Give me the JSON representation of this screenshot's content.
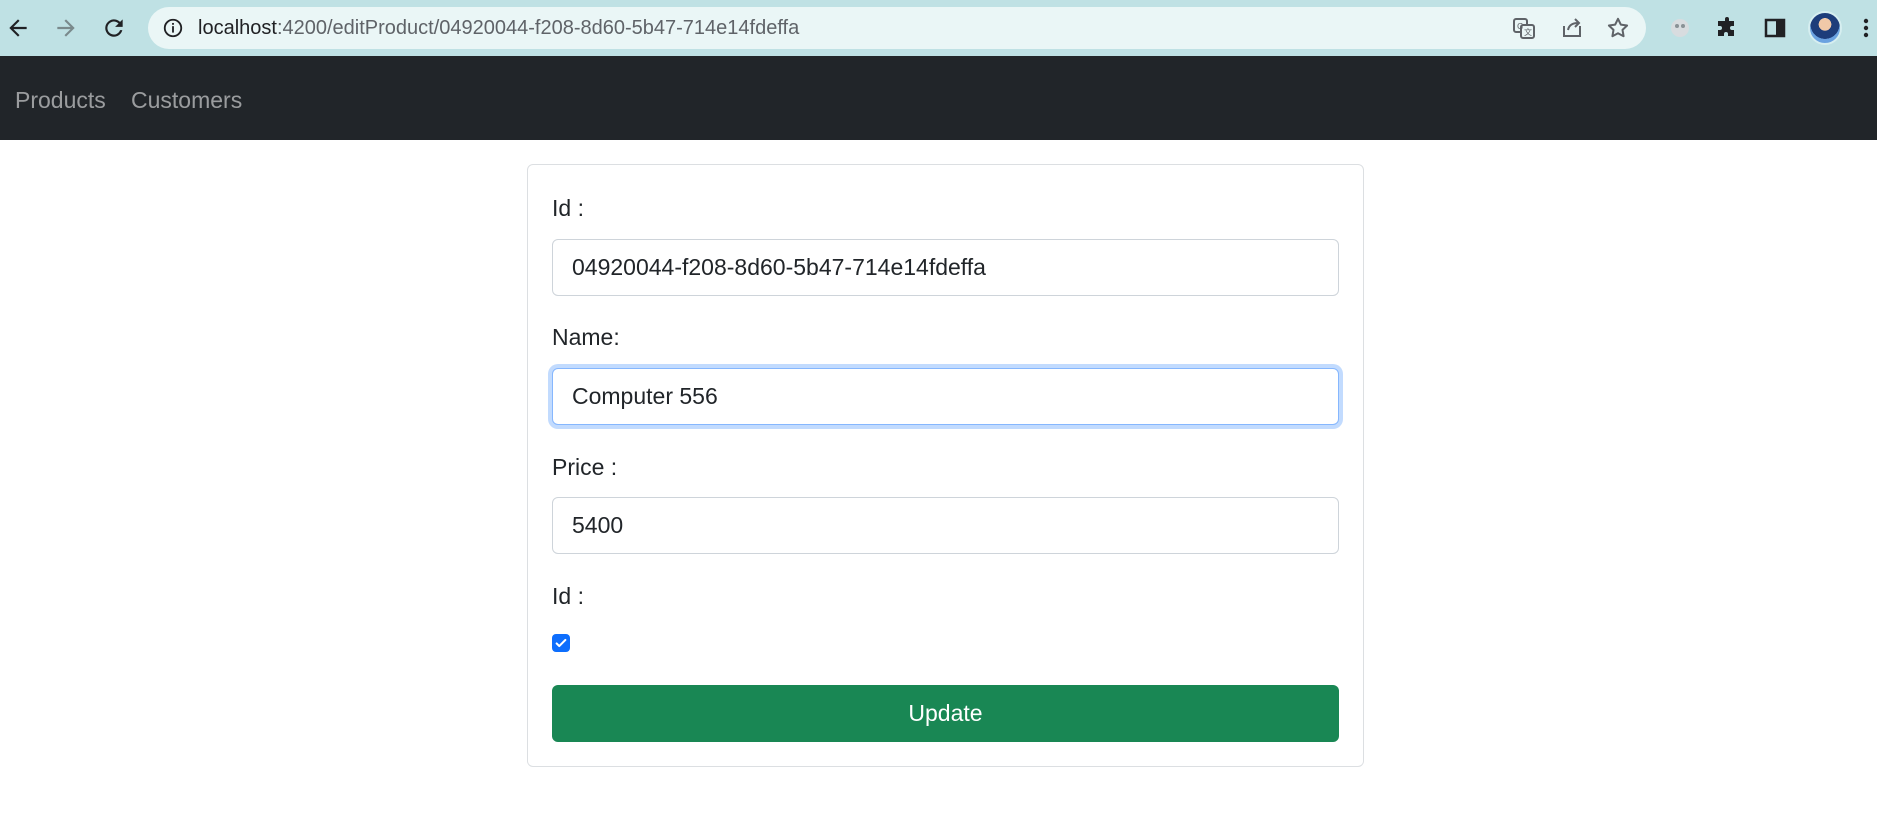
{
  "browser": {
    "url_host": "localhost",
    "url_path": ":4200/editProduct/04920044-f208-8d60-5b47-714e14fdeffa",
    "icons": [
      "back-icon",
      "forward-icon",
      "reload-icon",
      "info-icon",
      "translate-icon",
      "share-icon",
      "bookmark-star-icon",
      "extension-icon",
      "puzzle-icon",
      "side-panel-icon",
      "profile-avatar",
      "menu-icon"
    ]
  },
  "navbar": {
    "links": [
      "Products",
      "Customers"
    ]
  },
  "form": {
    "id_label": "Id :",
    "id_value": "04920044-f208-8d60-5b47-714e14fdeffa",
    "name_label": "Name:",
    "name_value": "Computer 556",
    "price_label": "Price :",
    "price_value": "5400",
    "selected_label": "Id :",
    "selected_checked": true,
    "submit_label": "Update"
  },
  "colors": {
    "chrome_bg": "#bfe1e4",
    "navbar_bg": "#212529",
    "button_bg": "#198754",
    "checkbox_bg": "#0d6efd"
  }
}
